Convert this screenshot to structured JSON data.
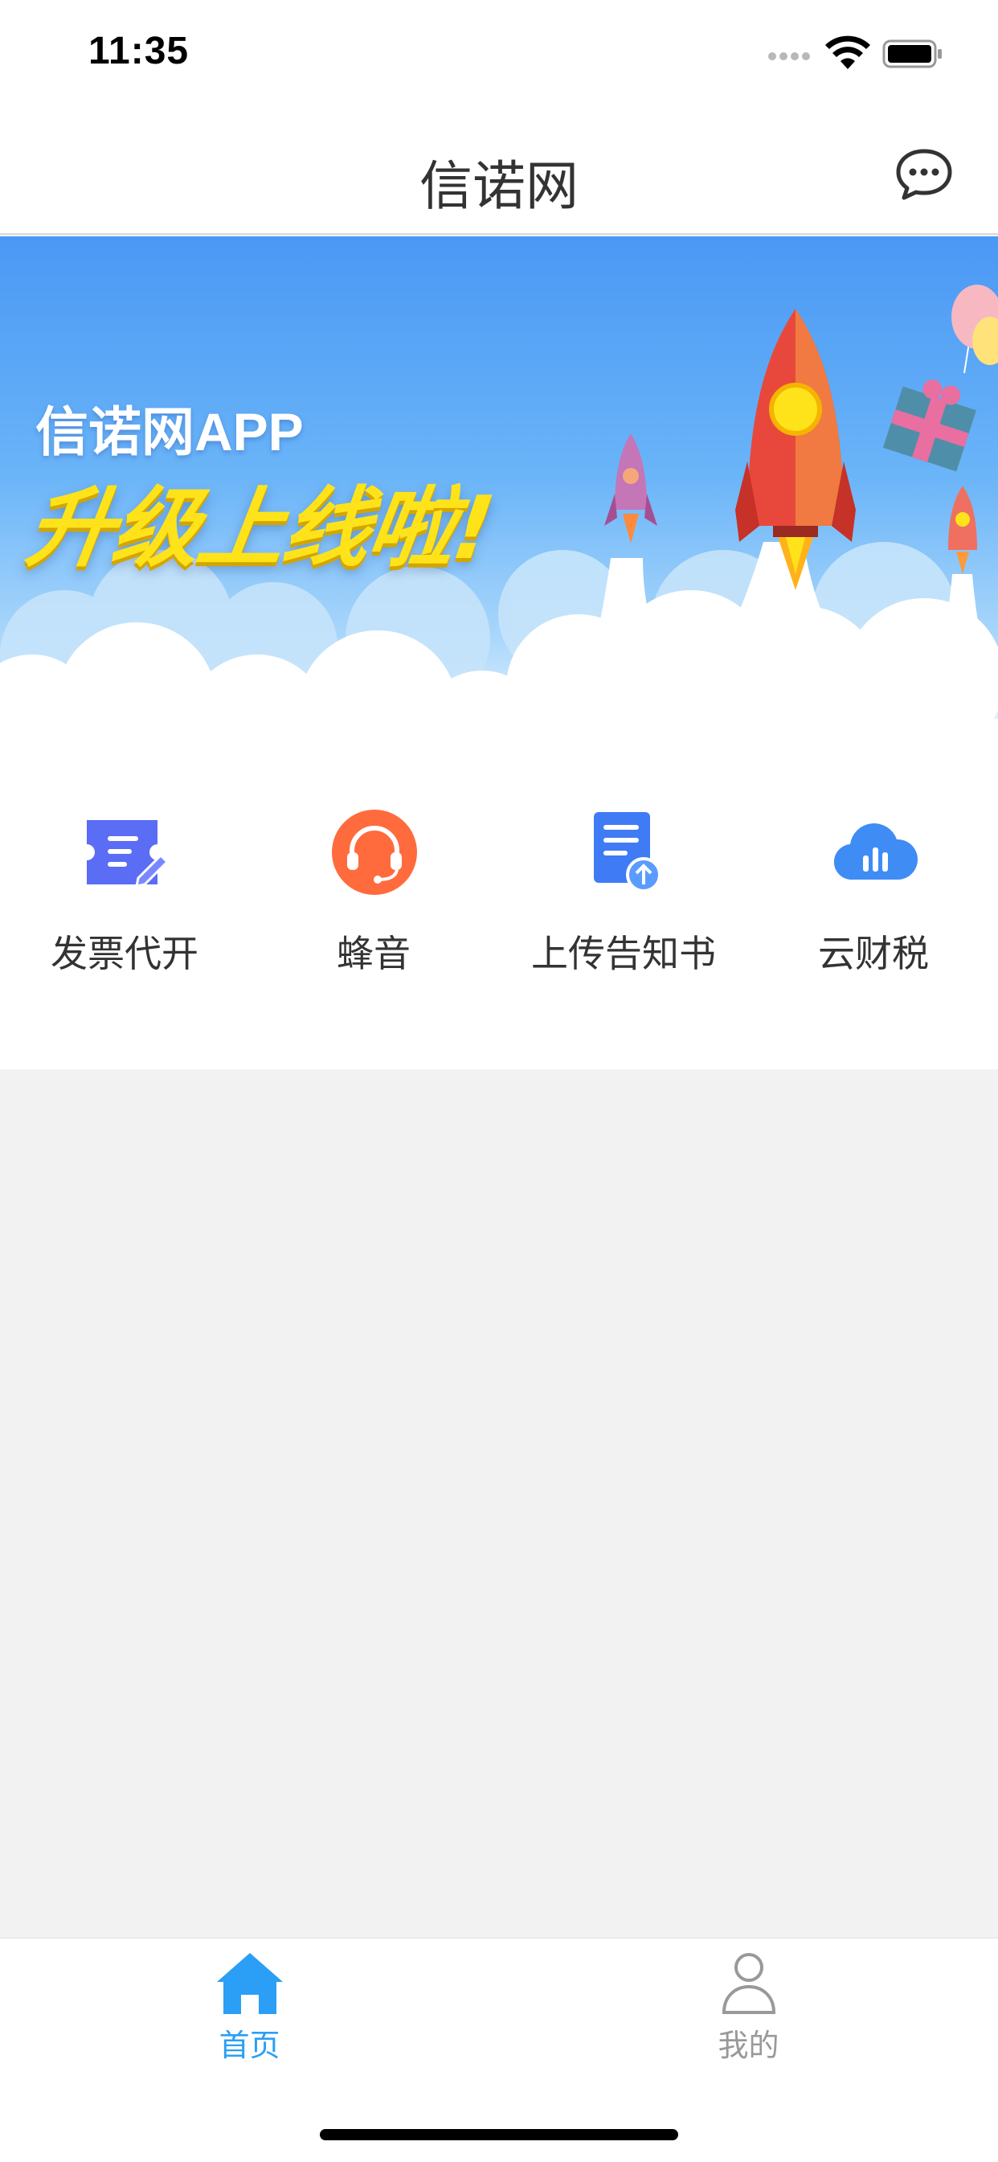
{
  "status_bar": {
    "time": "11:35"
  },
  "nav": {
    "title": "信诺网"
  },
  "banner": {
    "line1": "信诺网APP",
    "line2": "升级上线啦!"
  },
  "quick_menu": [
    {
      "label": "发票代开",
      "icon": "invoice-edit-icon",
      "color": "#5b6cf5"
    },
    {
      "label": "蜂音",
      "icon": "headset-icon",
      "color": "#ff6b3d"
    },
    {
      "label": "上传告知书",
      "icon": "document-upload-icon",
      "color": "#3f7bf5"
    },
    {
      "label": "云财税",
      "icon": "cloud-chart-icon",
      "color": "#3f8cf5"
    }
  ],
  "tab_bar": {
    "home": {
      "label": "首页",
      "color": "#2a9ff5"
    },
    "mine": {
      "label": "我的",
      "color": "#999999"
    }
  }
}
